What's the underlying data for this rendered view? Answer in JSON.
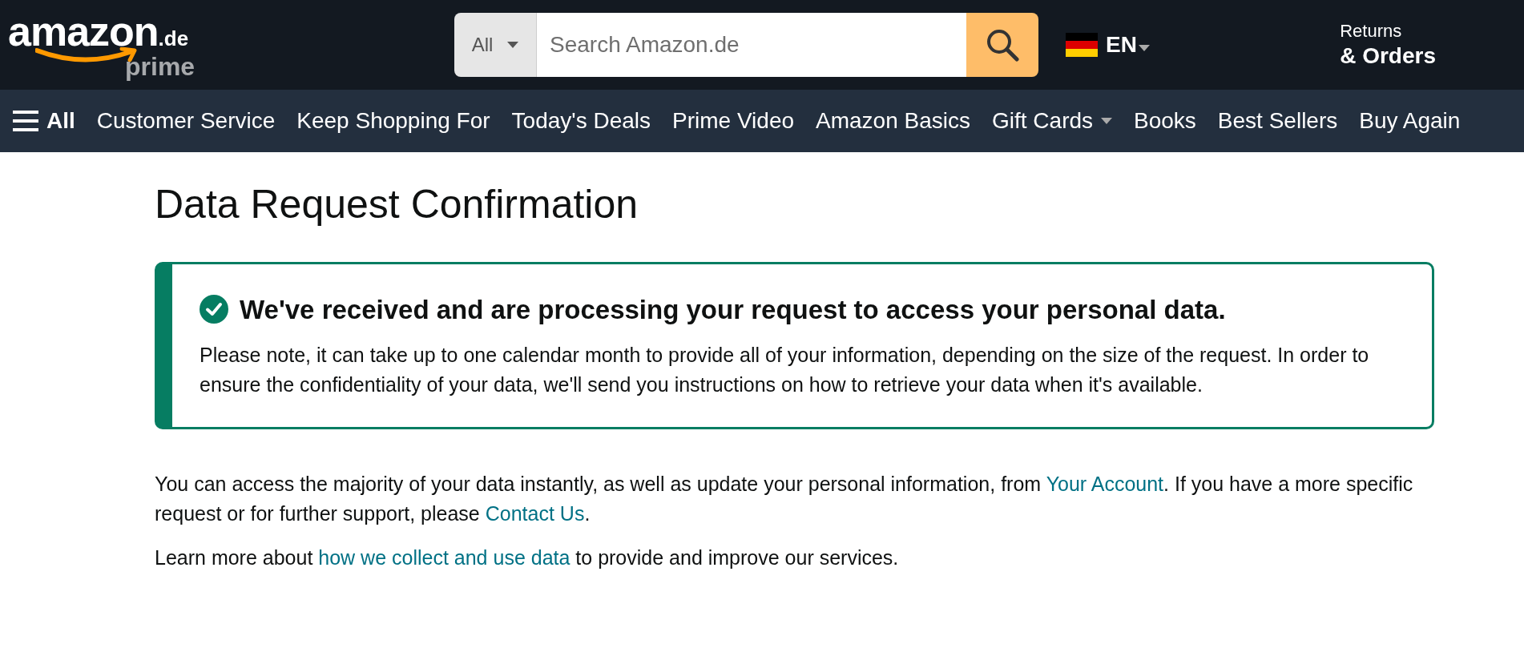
{
  "header": {
    "logo": {
      "wordmark": "amazon",
      "domain": ".de",
      "tier": "prime"
    },
    "search": {
      "category": "All",
      "placeholder": "Search Amazon.de"
    },
    "language": {
      "code": "EN"
    },
    "returns": {
      "line1": "Returns",
      "line2": "& Orders"
    }
  },
  "nav": {
    "menu_label": "All",
    "items": [
      {
        "label": "Customer Service",
        "dropdown": false
      },
      {
        "label": "Keep Shopping For",
        "dropdown": false
      },
      {
        "label": "Today's Deals",
        "dropdown": false
      },
      {
        "label": "Prime Video",
        "dropdown": false
      },
      {
        "label": "Amazon Basics",
        "dropdown": false
      },
      {
        "label": "Gift Cards",
        "dropdown": true
      },
      {
        "label": "Books",
        "dropdown": false
      },
      {
        "label": "Best Sellers",
        "dropdown": false
      },
      {
        "label": "Buy Again",
        "dropdown": false
      }
    ]
  },
  "page": {
    "title": "Data Request Confirmation",
    "alert": {
      "kind": "success",
      "heading": "We've received and are processing your request to access your personal data.",
      "body": "Please note, it can take up to one calendar month to provide all of your information, depending on the size of the request. In order to ensure the confidentiality of your data, we'll send you instructions on how to retrieve your data when it's available."
    },
    "paragraphs": [
      [
        {
          "text": "You can access the majority of your data instantly, as well as update your personal information, from ",
          "link": false
        },
        {
          "text": "Your Account",
          "link": true
        },
        {
          "text": ". If you have a more specific request or for further support, please ",
          "link": false
        },
        {
          "text": "Contact Us",
          "link": true
        },
        {
          "text": ".",
          "link": false
        }
      ],
      [
        {
          "text": "Learn more about ",
          "link": false
        },
        {
          "text": "how we collect and use data",
          "link": true
        },
        {
          "text": " to provide and improve our services.",
          "link": false
        }
      ]
    ]
  }
}
